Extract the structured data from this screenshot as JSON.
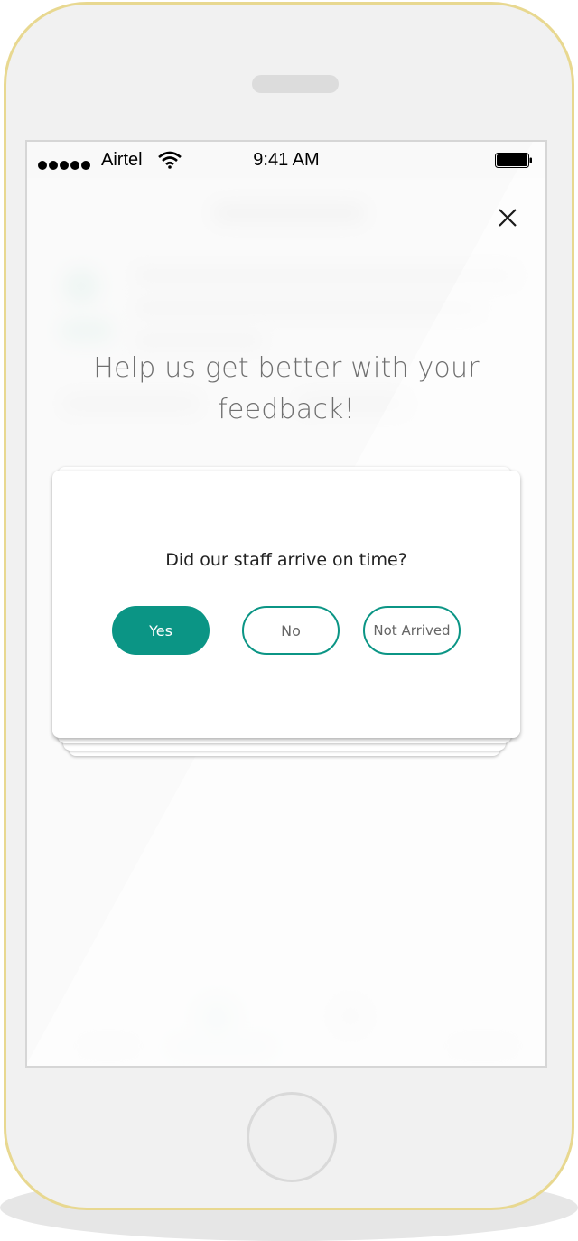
{
  "status_bar": {
    "carrier": "Airtel",
    "time": "9:41 AM"
  },
  "feedback": {
    "headline_line1": "Help us get better with your",
    "headline_line2": "feedback!",
    "question": "Did our staff arrive on time?",
    "options": {
      "yes": "Yes",
      "no": "No",
      "not_arrived": "Not Arrived"
    },
    "selected": "yes"
  },
  "icons": {
    "close": "close-icon",
    "wifi": "wifi-icon",
    "battery": "battery-icon",
    "signal": "signal-dots-icon"
  },
  "colors": {
    "accent": "#0b9585",
    "phone_frame": "#e8d890",
    "headline_text": "#6f6f6f"
  }
}
